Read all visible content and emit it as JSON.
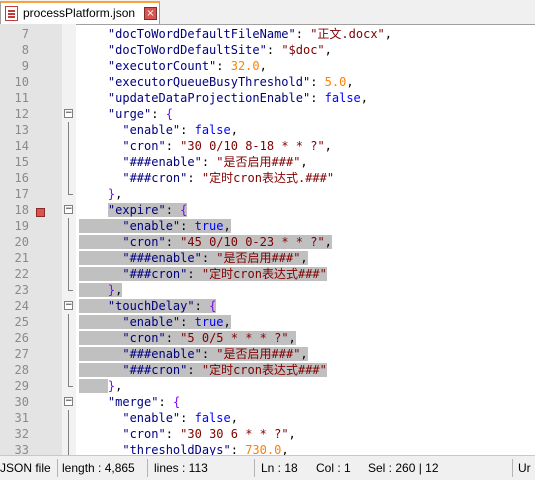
{
  "tab": {
    "title": "processPlatform.json",
    "close_glyph": "×"
  },
  "editor": {
    "lines": [
      {
        "num": "7",
        "tokens": [
          {
            "t": "    "
          },
          {
            "t": "\"docToWordDefaultFileName\"",
            "c": "k"
          },
          {
            "t": ": "
          },
          {
            "t": "\"正文.docx\"",
            "c": "s"
          },
          {
            "t": ","
          }
        ]
      },
      {
        "num": "8",
        "tokens": [
          {
            "t": "    "
          },
          {
            "t": "\"docToWordDefaultSite\"",
            "c": "k"
          },
          {
            "t": ": "
          },
          {
            "t": "\"$doc\"",
            "c": "s"
          },
          {
            "t": ","
          }
        ]
      },
      {
        "num": "9",
        "tokens": [
          {
            "t": "    "
          },
          {
            "t": "\"executorCount\"",
            "c": "k"
          },
          {
            "t": ": "
          },
          {
            "t": "32.0",
            "c": "n"
          },
          {
            "t": ","
          }
        ]
      },
      {
        "num": "10",
        "tokens": [
          {
            "t": "    "
          },
          {
            "t": "\"executorQueueBusyThreshold\"",
            "c": "k"
          },
          {
            "t": ": "
          },
          {
            "t": "5.0",
            "c": "n"
          },
          {
            "t": ","
          }
        ]
      },
      {
        "num": "11",
        "tokens": [
          {
            "t": "    "
          },
          {
            "t": "\"updateDataProjectionEnable\"",
            "c": "k"
          },
          {
            "t": ": "
          },
          {
            "t": "false",
            "c": "b"
          },
          {
            "t": ","
          }
        ]
      },
      {
        "num": "12",
        "fold": "box",
        "tokens": [
          {
            "t": "    "
          },
          {
            "t": "\"urge\"",
            "c": "k"
          },
          {
            "t": ": "
          },
          {
            "t": "{",
            "c": "o"
          }
        ]
      },
      {
        "num": "13",
        "fold": "line",
        "tokens": [
          {
            "t": "      "
          },
          {
            "t": "\"enable\"",
            "c": "k"
          },
          {
            "t": ": "
          },
          {
            "t": "false",
            "c": "b"
          },
          {
            "t": ","
          }
        ]
      },
      {
        "num": "14",
        "fold": "line",
        "tokens": [
          {
            "t": "      "
          },
          {
            "t": "\"cron\"",
            "c": "k"
          },
          {
            "t": ": "
          },
          {
            "t": "\"30 0/10 8-18 * * ?\"",
            "c": "s"
          },
          {
            "t": ","
          }
        ]
      },
      {
        "num": "15",
        "fold": "line",
        "tokens": [
          {
            "t": "      "
          },
          {
            "t": "\"###enable\"",
            "c": "k"
          },
          {
            "t": ": "
          },
          {
            "t": "\"是否启用###\"",
            "c": "s"
          },
          {
            "t": ","
          }
        ]
      },
      {
        "num": "16",
        "fold": "line",
        "tokens": [
          {
            "t": "      "
          },
          {
            "t": "\"###cron\"",
            "c": "k"
          },
          {
            "t": ": "
          },
          {
            "t": "\"定时cron表达式.###\"",
            "c": "s"
          }
        ]
      },
      {
        "num": "17",
        "fold": "end",
        "tokens": [
          {
            "t": "    "
          },
          {
            "t": "}",
            "c": "o"
          },
          {
            "t": ","
          }
        ]
      },
      {
        "num": "18",
        "fold": "box",
        "bookmark": true,
        "hl_from": 2,
        "tokens": [
          {
            "t": "  "
          },
          {
            "t": "  "
          },
          {
            "t": "\"expire\"",
            "c": "k"
          },
          {
            "t": ": "
          },
          {
            "t": "{",
            "c": "o"
          }
        ]
      },
      {
        "num": "19",
        "fold": "line",
        "hl_from": 0,
        "tokens": [
          {
            "t": "      "
          },
          {
            "t": "\"enable\"",
            "c": "k"
          },
          {
            "t": ": "
          },
          {
            "t": "true",
            "c": "b"
          },
          {
            "t": ","
          }
        ]
      },
      {
        "num": "20",
        "fold": "line",
        "hl_from": 0,
        "tokens": [
          {
            "t": "      "
          },
          {
            "t": "\"cron\"",
            "c": "k"
          },
          {
            "t": ": "
          },
          {
            "t": "\"45 0/10 0-23 * * ?\"",
            "c": "s"
          },
          {
            "t": ","
          }
        ]
      },
      {
        "num": "21",
        "fold": "line",
        "hl_from": 0,
        "tokens": [
          {
            "t": "      "
          },
          {
            "t": "\"###enable\"",
            "c": "k"
          },
          {
            "t": ": "
          },
          {
            "t": "\"是否启用###\"",
            "c": "s"
          },
          {
            "t": ","
          }
        ]
      },
      {
        "num": "22",
        "fold": "line",
        "hl_from": 0,
        "tokens": [
          {
            "t": "      "
          },
          {
            "t": "\"###cron\"",
            "c": "k"
          },
          {
            "t": ": "
          },
          {
            "t": "\"定时cron表达式###\"",
            "c": "s"
          }
        ]
      },
      {
        "num": "23",
        "fold": "end",
        "hl_from": 0,
        "tokens": [
          {
            "t": "    "
          },
          {
            "t": "}",
            "c": "o"
          },
          {
            "t": ","
          }
        ]
      },
      {
        "num": "24",
        "fold": "box",
        "hl_from": 0,
        "tokens": [
          {
            "t": "    "
          },
          {
            "t": "\"touchDelay\"",
            "c": "k"
          },
          {
            "t": ": "
          },
          {
            "t": "{",
            "c": "o"
          }
        ]
      },
      {
        "num": "25",
        "fold": "line",
        "hl_from": 0,
        "tokens": [
          {
            "t": "      "
          },
          {
            "t": "\"enable\"",
            "c": "k"
          },
          {
            "t": ": "
          },
          {
            "t": "true",
            "c": "b"
          },
          {
            "t": ","
          }
        ]
      },
      {
        "num": "26",
        "fold": "line",
        "hl_from": 0,
        "tokens": [
          {
            "t": "      "
          },
          {
            "t": "\"cron\"",
            "c": "k"
          },
          {
            "t": ": "
          },
          {
            "t": "\"5 0/5 * * * ?\"",
            "c": "s"
          },
          {
            "t": ","
          }
        ]
      },
      {
        "num": "27",
        "fold": "line",
        "hl_from": 0,
        "tokens": [
          {
            "t": "      "
          },
          {
            "t": "\"###enable\"",
            "c": "k"
          },
          {
            "t": ": "
          },
          {
            "t": "\"是否启用###\"",
            "c": "s"
          },
          {
            "t": ","
          }
        ]
      },
      {
        "num": "28",
        "fold": "line",
        "hl_from": 0,
        "tokens": [
          {
            "t": "      "
          },
          {
            "t": "\"###cron\"",
            "c": "k"
          },
          {
            "t": ": "
          },
          {
            "t": "\"定时cron表达式###\"",
            "c": "s"
          }
        ]
      },
      {
        "num": "29",
        "fold": "end",
        "hl_from": 0,
        "hl_to": 1,
        "tokens": [
          {
            "t": "    "
          },
          {
            "t": "}",
            "c": "o"
          },
          {
            "t": ","
          }
        ]
      },
      {
        "num": "30",
        "fold": "box",
        "tokens": [
          {
            "t": "    "
          },
          {
            "t": "\"merge\"",
            "c": "k"
          },
          {
            "t": ": "
          },
          {
            "t": "{",
            "c": "o"
          }
        ]
      },
      {
        "num": "31",
        "fold": "line",
        "tokens": [
          {
            "t": "      "
          },
          {
            "t": "\"enable\"",
            "c": "k"
          },
          {
            "t": ": "
          },
          {
            "t": "false",
            "c": "b"
          },
          {
            "t": ","
          }
        ]
      },
      {
        "num": "32",
        "fold": "line",
        "tokens": [
          {
            "t": "      "
          },
          {
            "t": "\"cron\"",
            "c": "k"
          },
          {
            "t": ": "
          },
          {
            "t": "\"30 30 6 * * ?\"",
            "c": "s"
          },
          {
            "t": ","
          }
        ]
      },
      {
        "num": "33",
        "fold": "line",
        "tokens": [
          {
            "t": "      "
          },
          {
            "t": "\"thresholdDays\"",
            "c": "k"
          },
          {
            "t": ": "
          },
          {
            "t": "730.0",
            "c": "n"
          },
          {
            "t": ","
          }
        ]
      }
    ]
  },
  "statusbar": {
    "file_type": "JSON file",
    "length": "length : 4,865",
    "lines": "lines : 113",
    "ln": "Ln : 18",
    "col": "Col : 1",
    "sel": "Sel : 260 | 12",
    "eol": "Ur"
  },
  "colors": {
    "key": "#000080",
    "string": "#800000",
    "number": "#ff8000",
    "boolean": "#0000ff",
    "operator": "#8000ff",
    "selection": "#c0c0c0",
    "bookmark": "#d9534f"
  }
}
